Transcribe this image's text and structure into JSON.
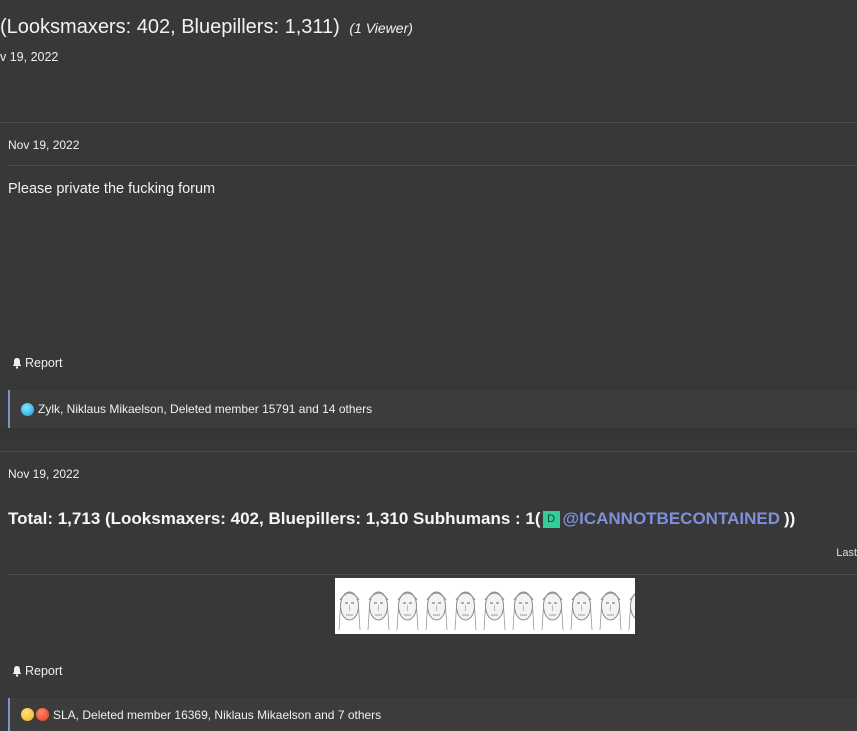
{
  "thread": {
    "title": "(Looksmaxers: 402, Bluepillers: 1,311)",
    "viewer": "(1 Viewer)",
    "date": "v 19, 2022"
  },
  "posts": [
    {
      "date": "Nov 19, 2022",
      "body": "Please private the fucking forum",
      "report_label": "Report",
      "reactions": {
        "icons": [
          "like-icon"
        ],
        "names": "Zylk, Niklaus Mikaelson, Deleted member 15791 and 14 others"
      }
    },
    {
      "date": "Nov 19, 2022",
      "total_text": "Total: 1,713 (Looksmaxers: 402, Bluepillers: 1,310 Subhumans : 1(",
      "mention_avatar_letter": "D",
      "mention": "@ICANNOTBECONTAINED",
      "total_close": "))",
      "last_edit": "Last",
      "report_label": "Report",
      "reactions": {
        "icons": [
          "haha-icon",
          "angry-icon"
        ],
        "names": "SLA, Deleted member 16369, Niklaus Mikaelson and 7 others"
      }
    }
  ],
  "colors": {
    "background": "#383838",
    "accent_border": "#7f93c4",
    "mention": "#7f8fdc",
    "avatar": "#33cc9a"
  }
}
